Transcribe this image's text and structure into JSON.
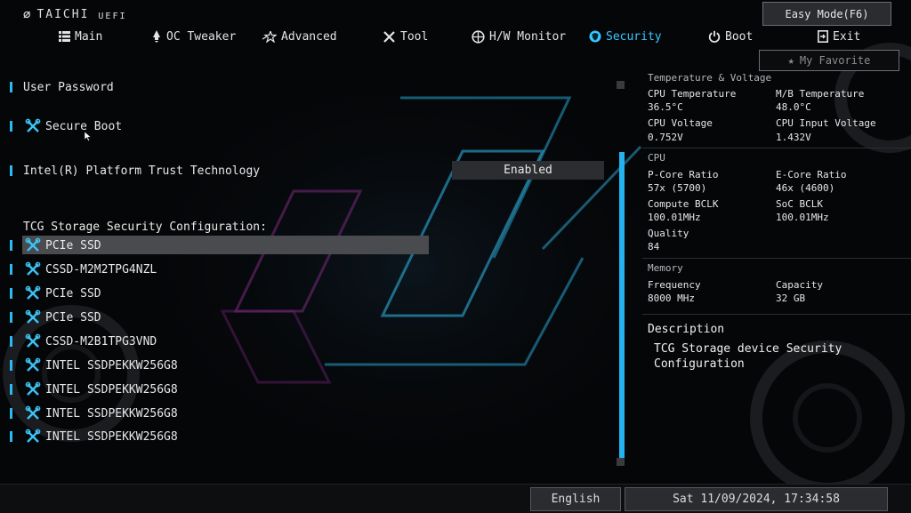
{
  "header": {
    "logo_mark": "⌀",
    "brand": "TAICHI",
    "uefi": "UEFI",
    "easy_mode_label": "Easy Mode(F6)",
    "my_favorite_label": "My Favorite"
  },
  "nav": {
    "items": [
      {
        "label": "Main",
        "icon": "main-grid-icon"
      },
      {
        "label": "OC Tweaker",
        "icon": "rocket-icon"
      },
      {
        "label": "Advanced",
        "icon": "star-advanced-icon"
      },
      {
        "label": "Tool",
        "icon": "tools-icon"
      },
      {
        "label": "H/W Monitor",
        "icon": "monitor-icon"
      },
      {
        "label": "Security",
        "icon": "shield-icon"
      },
      {
        "label": "Boot",
        "icon": "power-icon"
      },
      {
        "label": "Exit",
        "icon": "exit-icon"
      }
    ],
    "active": "Security"
  },
  "main": {
    "items": [
      {
        "label": "User Password",
        "has_wrench": false
      },
      {
        "label": "Secure Boot",
        "has_wrench": true
      },
      {
        "label": "Intel(R) Platform Trust Technology",
        "has_wrench": false,
        "value": "Enabled"
      }
    ],
    "section_header": "TCG Storage Security Configuration:",
    "devices": [
      {
        "label": "PCIe SSD",
        "selected": true
      },
      {
        "label": "CSSD-M2M2TPG4NZL",
        "selected": false
      },
      {
        "label": "PCIe SSD",
        "selected": false
      },
      {
        "label": "PCIe SSD",
        "selected": false
      },
      {
        "label": "CSSD-M2B1TPG3VND",
        "selected": false
      },
      {
        "label": "INTEL SSDPEKKW256G8",
        "selected": false
      },
      {
        "label": "INTEL SSDPEKKW256G8",
        "selected": false
      },
      {
        "label": "INTEL SSDPEKKW256G8",
        "selected": false
      },
      {
        "label": "INTEL SSDPEKKW256G8",
        "selected": false
      }
    ]
  },
  "panel": {
    "temp_voltage_title": "Temperature & Voltage",
    "cpu_temp_label": "CPU Temperature",
    "cpu_temp_value": "36.5°C",
    "mb_temp_label": "M/B Temperature",
    "mb_temp_value": "48.0°C",
    "cpu_voltage_label": "CPU Voltage",
    "cpu_voltage_value": "0.752V",
    "cpu_input_voltage_label": "CPU Input Voltage",
    "cpu_input_voltage_value": "1.432V",
    "cpu_title": "CPU",
    "pcore_label": "P-Core Ratio",
    "pcore_value": "57x (5700)",
    "ecore_label": "E-Core Ratio",
    "ecore_value": "46x (4600)",
    "compute_bclk_label": "Compute BCLK",
    "compute_bclk_value": "100.01MHz",
    "soc_bclk_label": "SoC BCLK",
    "soc_bclk_value": "100.01MHz",
    "quality_label": "Quality",
    "quality_value": "84",
    "memory_title": "Memory",
    "frequency_label": "Frequency",
    "frequency_value": "8000 MHz",
    "capacity_label": "Capacity",
    "capacity_value": "32 GB",
    "description_title": "Description",
    "description_text": "TCG Storage device Security Configuration"
  },
  "footer": {
    "language": "English",
    "datetime": "Sat 11/09/2024, 17:34:58"
  },
  "colors": {
    "accent": "#35c8ff",
    "highlight_row": "#4a4b4e",
    "background": "#050608"
  }
}
